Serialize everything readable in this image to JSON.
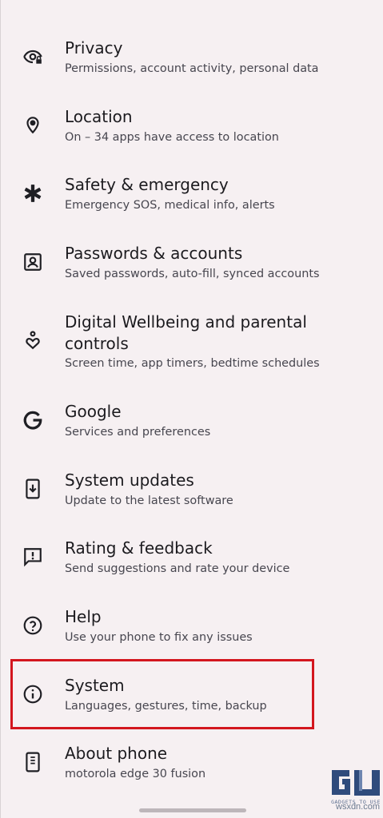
{
  "settings": {
    "items": [
      {
        "title": "Privacy",
        "subtitle": "Permissions, account activity, personal data",
        "icon": "eye-lock-icon"
      },
      {
        "title": "Location",
        "subtitle": "On – 34 apps have access to location",
        "icon": "location-pin-icon"
      },
      {
        "title": "Safety & emergency",
        "subtitle": "Emergency SOS, medical info, alerts",
        "icon": "asterisk-icon"
      },
      {
        "title": "Passwords & accounts",
        "subtitle": "Saved passwords, auto-fill, synced accounts",
        "icon": "account-box-icon"
      },
      {
        "title": "Digital Wellbeing and parental controls",
        "subtitle": "Screen time, app timers, bedtime schedules",
        "icon": "wellbeing-heart-icon"
      },
      {
        "title": "Google",
        "subtitle": "Services and preferences",
        "icon": "google-g-icon"
      },
      {
        "title": "System updates",
        "subtitle": "Update to the latest software",
        "icon": "system-update-icon"
      },
      {
        "title": "Rating & feedback",
        "subtitle": "Send suggestions and rate your device",
        "icon": "feedback-icon"
      },
      {
        "title": "Help",
        "subtitle": "Use your phone to fix any issues",
        "icon": "help-circle-icon"
      },
      {
        "title": "System",
        "subtitle": "Languages, gestures, time, backup",
        "icon": "info-icon"
      },
      {
        "title": "About phone",
        "subtitle": "motorola edge 30 fusion",
        "icon": "phone-icon"
      }
    ]
  },
  "watermark": {
    "brand_text": "GADGETS TO USE",
    "site_text": "wsxdn.com"
  },
  "colors": {
    "background": "#f6f0f2",
    "highlight": "#d3161e"
  }
}
